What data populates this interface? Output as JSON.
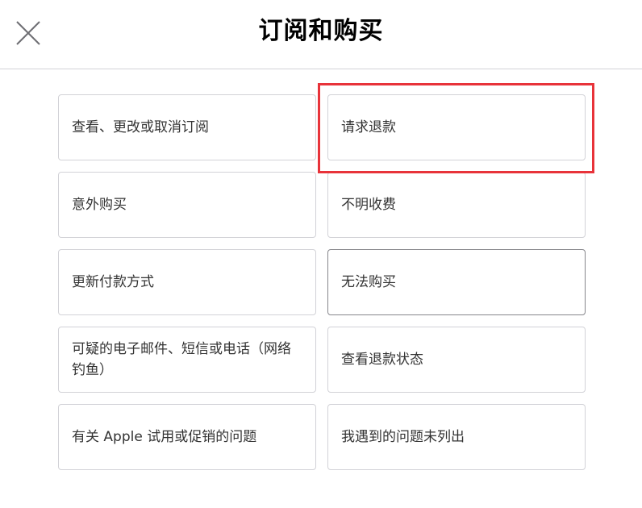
{
  "header": {
    "title": "订阅和购买",
    "close_icon": "close-icon"
  },
  "options": [
    {
      "label": "查看、更改或取消订阅"
    },
    {
      "label": "请求退款"
    },
    {
      "label": "意外购买"
    },
    {
      "label": "不明收费"
    },
    {
      "label": "更新付款方式"
    },
    {
      "label": "无法购买"
    },
    {
      "label": "可疑的电子邮件、短信或电话（网络钓鱼）"
    },
    {
      "label": "查看退款状态"
    },
    {
      "label": "有关 Apple 试用或促销的问题"
    },
    {
      "label": "我遇到的问题未列出"
    }
  ],
  "colors": {
    "highlight": "#e8333a",
    "border": "#d2d2d7",
    "text": "#333333"
  }
}
